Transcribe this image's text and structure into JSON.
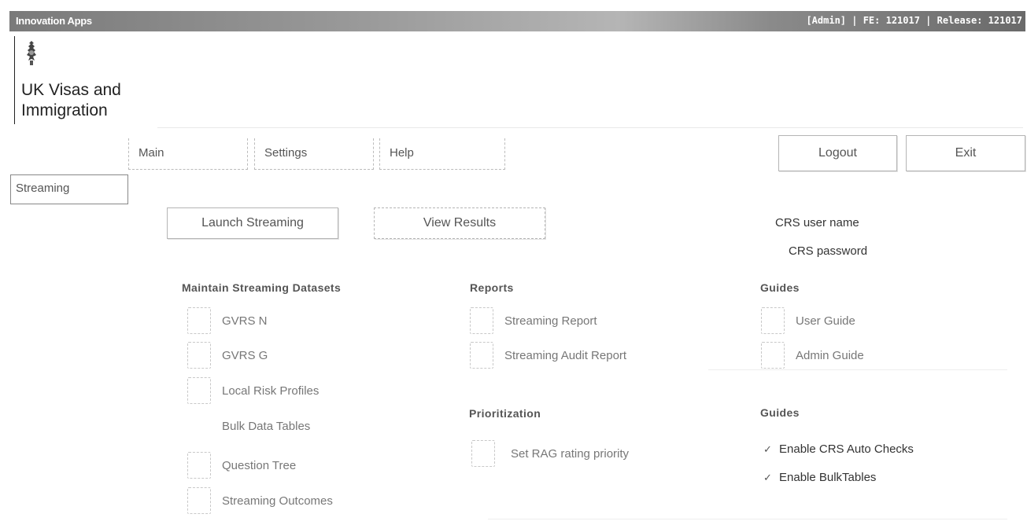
{
  "topbar": {
    "app_name": "Innovation Apps",
    "session_info": "[Admin] | FE: 121017 | Release: 121017"
  },
  "logo": {
    "icon": "crest-icon",
    "line1": "UK Visas and",
    "line2": "Immigration"
  },
  "nav": {
    "tabs": [
      {
        "label": "Main"
      },
      {
        "label": "Settings"
      },
      {
        "label": "Help"
      }
    ],
    "logout_label": "Logout",
    "exit_label": "Exit"
  },
  "side": {
    "active_tab": "Streaming"
  },
  "actions": {
    "launch_label": "Launch Streaming",
    "results_label": "View Results"
  },
  "crs": {
    "username_label": "CRS user name",
    "password_label": "CRS password"
  },
  "datasets": {
    "title": "Maintain Streaming Datasets",
    "items": [
      {
        "label": "GVRS N"
      },
      {
        "label": "GVRS G"
      },
      {
        "label": "Local Risk Profiles"
      },
      {
        "label": "Bulk Data Tables"
      },
      {
        "label": "Question Tree"
      },
      {
        "label": "Streaming Outcomes"
      }
    ]
  },
  "reports": {
    "title": "Reports",
    "items": [
      {
        "label": "Streaming Report"
      },
      {
        "label": "Streaming Audit Report"
      }
    ]
  },
  "prioritization": {
    "title": "Prioritization",
    "items": [
      {
        "label": "Set RAG rating priority"
      }
    ]
  },
  "guides": {
    "title": "Guides",
    "items": [
      {
        "label": "User Guide"
      },
      {
        "label": "Admin Guide"
      }
    ]
  },
  "guides_options": {
    "title": "Guides",
    "options": [
      {
        "label": "Enable CRS Auto Checks",
        "checked": true
      },
      {
        "label": "Enable BulkTables",
        "checked": true
      }
    ]
  }
}
